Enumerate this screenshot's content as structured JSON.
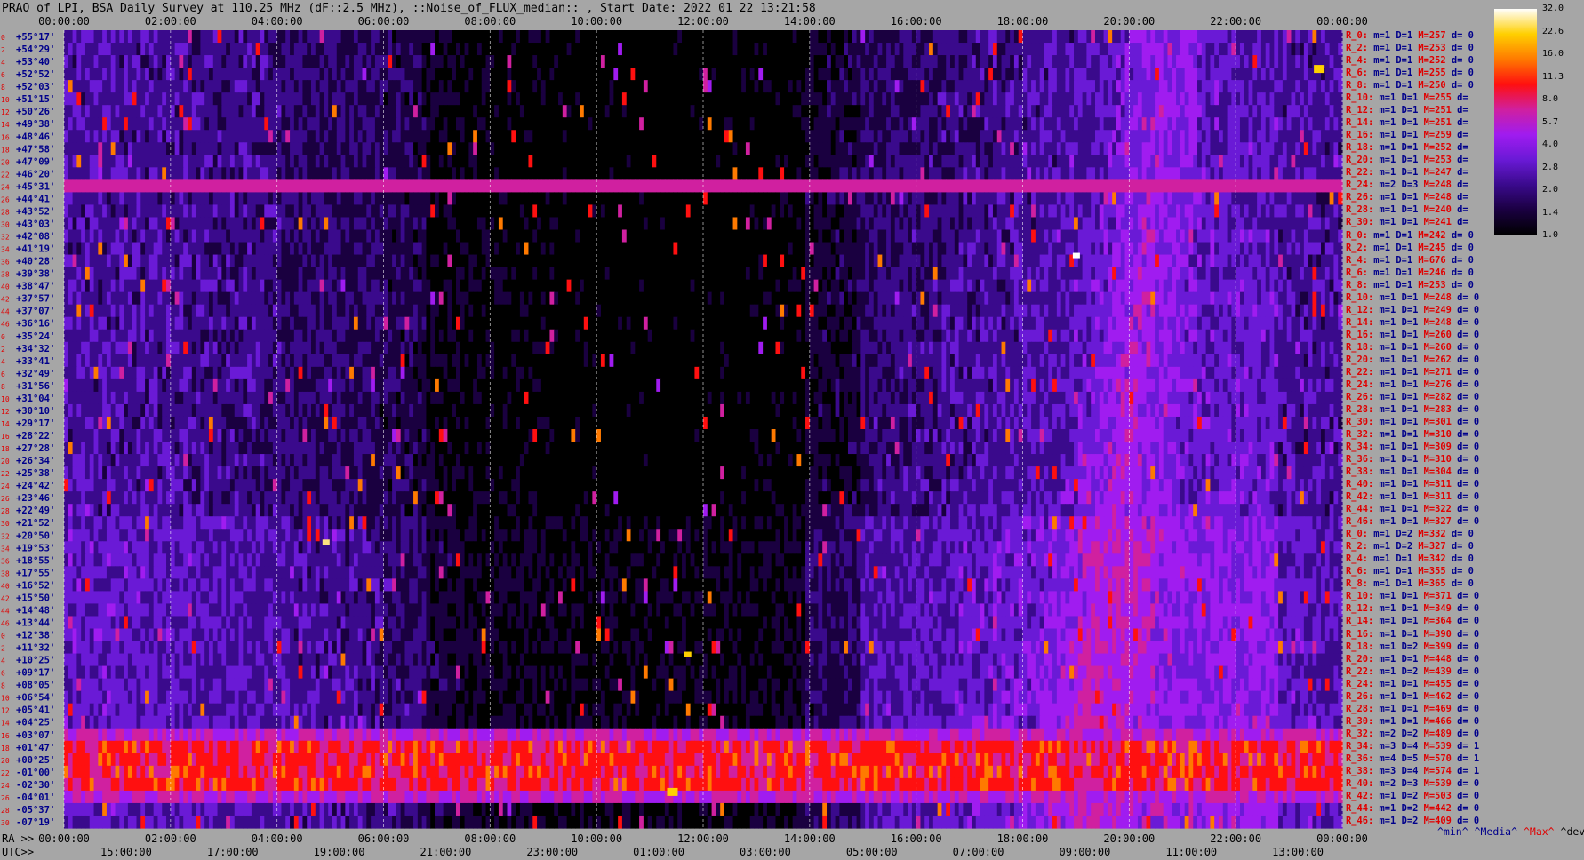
{
  "title": "PRAO of LPI, BSA Daily Survey at 110.25 MHz (dF::2.5 MHz), ::Noise_of_FLUX_median:: , Start Date: 2022 01 22 13:21:58",
  "chart_data": {
    "type": "heatmap",
    "ra_label": "RA >>",
    "utc_label": "UTC>>",
    "top_ticks": [
      "00:00:00",
      "02:00:00",
      "04:00:00",
      "06:00:00",
      "08:00:00",
      "10:00:00",
      "12:00:00",
      "14:00:00",
      "16:00:00",
      "18:00:00",
      "20:00:00",
      "22:00:00",
      "00:00:00"
    ],
    "ra_ticks": [
      "00:00:00",
      "02:00:00",
      "04:00:00",
      "06:00:00",
      "08:00:00",
      "10:00:00",
      "12:00:00",
      "14:00:00",
      "16:00:00",
      "18:00:00",
      "20:00:00",
      "22:00:00",
      "00:00:00"
    ],
    "utc_ticks": [
      "15:00:00",
      "17:00:00",
      "19:00:00",
      "21:00:00",
      "23:00:00",
      "01:00:00",
      "03:00:00",
      "05:00:00",
      "07:00:00",
      "09:00:00",
      "11:00:00",
      "13:00:00"
    ],
    "declinations": [
      "+55°17'",
      "+54°29'",
      "+53°40'",
      "+52°52'",
      "+52°03'",
      "+51°15'",
      "+50°26'",
      "+49°38'",
      "+48°46'",
      "+47°58'",
      "+47°09'",
      "+46°20'",
      "+45°31'",
      "+44°41'",
      "+43°52'",
      "+43°03'",
      "+42°08'",
      "+41°19'",
      "+40°28'",
      "+39°38'",
      "+38°47'",
      "+37°57'",
      "+37°07'",
      "+36°16'",
      "+35°24'",
      "+34°32'",
      "+33°41'",
      "+32°49'",
      "+31°56'",
      "+31°04'",
      "+30°10'",
      "+29°17'",
      "+28°22'",
      "+27°28'",
      "+26°34'",
      "+25°38'",
      "+24°42'",
      "+23°46'",
      "+22°49'",
      "+21°52'",
      "+20°50'",
      "+19°53'",
      "+18°55'",
      "+17°55'",
      "+16°52'",
      "+15°50'",
      "+14°48'",
      "+13°44'",
      "+12°38'",
      "+11°32'",
      "+10°25'",
      "+09°17'",
      "+08°05'",
      "+06°54'",
      "+05°41'",
      "+04°25'",
      "+03°07'",
      "+01°47'",
      "+00°25'",
      "-01°00'",
      "-02°30'",
      "-04°01'",
      "-05°37'",
      "-07°19'"
    ],
    "row_indices": [
      "0",
      "2",
      "4",
      "6",
      "8",
      "10",
      "12",
      "14",
      "16",
      "18",
      "20",
      "22",
      "24",
      "26",
      "28",
      "30",
      "32",
      "34",
      "36",
      "38",
      "40",
      "42",
      "44",
      "46",
      "0",
      "2",
      "4",
      "6",
      "8",
      "10",
      "12",
      "14",
      "16",
      "18",
      "20",
      "22",
      "24",
      "26",
      "28",
      "30",
      "32",
      "34",
      "36",
      "38",
      "40",
      "42",
      "44",
      "46"
    ],
    "rows": [
      {
        "r": "R_0:",
        "m": "1",
        "D": "1",
        "M": "257",
        "d": "0"
      },
      {
        "r": "R_2:",
        "m": "1",
        "D": "1",
        "M": "253",
        "d": "0"
      },
      {
        "r": "R_4:",
        "m": "1",
        "D": "1",
        "M": "252",
        "d": "0"
      },
      {
        "r": "R_6:",
        "m": "1",
        "D": "1",
        "M": "255",
        "d": "0"
      },
      {
        "r": "R_8:",
        "m": "1",
        "D": "1",
        "M": "250",
        "d": "0"
      },
      {
        "r": "R_10:",
        "m": "1",
        "D": "1",
        "M": "255",
        "d": ""
      },
      {
        "r": "R_12:",
        "m": "1",
        "D": "1",
        "M": "251",
        "d": ""
      },
      {
        "r": "R_14:",
        "m": "1",
        "D": "1",
        "M": "251",
        "d": ""
      },
      {
        "r": "R_16:",
        "m": "1",
        "D": "1",
        "M": "259",
        "d": ""
      },
      {
        "r": "R_18:",
        "m": "1",
        "D": "1",
        "M": "252",
        "d": ""
      },
      {
        "r": "R_20:",
        "m": "1",
        "D": "1",
        "M": "253",
        "d": ""
      },
      {
        "r": "R_22:",
        "m": "1",
        "D": "1",
        "M": "247",
        "d": ""
      },
      {
        "r": "R_24:",
        "m": "2",
        "D": "3",
        "M": "248",
        "d": ""
      },
      {
        "r": "R_26:",
        "m": "1",
        "D": "1",
        "M": "248",
        "d": ""
      },
      {
        "r": "R_28:",
        "m": "1",
        "D": "1",
        "M": "240",
        "d": ""
      },
      {
        "r": "R_30:",
        "m": "1",
        "D": "1",
        "M": "241",
        "d": ""
      },
      {
        "r": "R_0:",
        "m": "1",
        "D": "1",
        "M": "242",
        "d": "0"
      },
      {
        "r": "R_2:",
        "m": "1",
        "D": "1",
        "M": "245",
        "d": "0"
      },
      {
        "r": "R_4:",
        "m": "1",
        "D": "1",
        "M": "676",
        "d": "0"
      },
      {
        "r": "R_6:",
        "m": "1",
        "D": "1",
        "M": "246",
        "d": "0"
      },
      {
        "r": "R_8:",
        "m": "1",
        "D": "1",
        "M": "253",
        "d": "0"
      },
      {
        "r": "R_10:",
        "m": "1",
        "D": "1",
        "M": "248",
        "d": "0"
      },
      {
        "r": "R_12:",
        "m": "1",
        "D": "1",
        "M": "249",
        "d": "0"
      },
      {
        "r": "R_14:",
        "m": "1",
        "D": "1",
        "M": "248",
        "d": "0"
      },
      {
        "r": "R_16:",
        "m": "1",
        "D": "1",
        "M": "260",
        "d": "0"
      },
      {
        "r": "R_18:",
        "m": "1",
        "D": "1",
        "M": "260",
        "d": "0"
      },
      {
        "r": "R_20:",
        "m": "1",
        "D": "1",
        "M": "262",
        "d": "0"
      },
      {
        "r": "R_22:",
        "m": "1",
        "D": "1",
        "M": "271",
        "d": "0"
      },
      {
        "r": "R_24:",
        "m": "1",
        "D": "1",
        "M": "276",
        "d": "0"
      },
      {
        "r": "R_26:",
        "m": "1",
        "D": "1",
        "M": "282",
        "d": "0"
      },
      {
        "r": "R_28:",
        "m": "1",
        "D": "1",
        "M": "283",
        "d": "0"
      },
      {
        "r": "R_30:",
        "m": "1",
        "D": "1",
        "M": "301",
        "d": "0"
      },
      {
        "r": "R_32:",
        "m": "1",
        "D": "1",
        "M": "310",
        "d": "0"
      },
      {
        "r": "R_34:",
        "m": "1",
        "D": "1",
        "M": "309",
        "d": "0"
      },
      {
        "r": "R_36:",
        "m": "1",
        "D": "1",
        "M": "310",
        "d": "0"
      },
      {
        "r": "R_38:",
        "m": "1",
        "D": "1",
        "M": "304",
        "d": "0"
      },
      {
        "r": "R_40:",
        "m": "1",
        "D": "1",
        "M": "311",
        "d": "0"
      },
      {
        "r": "R_42:",
        "m": "1",
        "D": "1",
        "M": "311",
        "d": "0"
      },
      {
        "r": "R_44:",
        "m": "1",
        "D": "1",
        "M": "322",
        "d": "0"
      },
      {
        "r": "R_46:",
        "m": "1",
        "D": "1",
        "M": "327",
        "d": "0"
      },
      {
        "r": "R_0:",
        "m": "1",
        "D": "2",
        "M": "332",
        "d": "0"
      },
      {
        "r": "R_2:",
        "m": "1",
        "D": "2",
        "M": "327",
        "d": "0"
      },
      {
        "r": "R_4:",
        "m": "1",
        "D": "1",
        "M": "342",
        "d": "0"
      },
      {
        "r": "R_6:",
        "m": "1",
        "D": "1",
        "M": "355",
        "d": "0"
      },
      {
        "r": "R_8:",
        "m": "1",
        "D": "1",
        "M": "365",
        "d": "0"
      },
      {
        "r": "R_10:",
        "m": "1",
        "D": "1",
        "M": "371",
        "d": "0"
      },
      {
        "r": "R_12:",
        "m": "1",
        "D": "1",
        "M": "349",
        "d": "0"
      },
      {
        "r": "R_14:",
        "m": "1",
        "D": "1",
        "M": "364",
        "d": "0"
      },
      {
        "r": "R_16:",
        "m": "1",
        "D": "1",
        "M": "390",
        "d": "0"
      },
      {
        "r": "R_18:",
        "m": "1",
        "D": "2",
        "M": "399",
        "d": "0"
      },
      {
        "r": "R_20:",
        "m": "1",
        "D": "1",
        "M": "448",
        "d": "0"
      },
      {
        "r": "R_22:",
        "m": "1",
        "D": "2",
        "M": "439",
        "d": "0"
      },
      {
        "r": "R_24:",
        "m": "1",
        "D": "1",
        "M": "455",
        "d": "0"
      },
      {
        "r": "R_26:",
        "m": "1",
        "D": "1",
        "M": "462",
        "d": "0"
      },
      {
        "r": "R_28:",
        "m": "1",
        "D": "1",
        "M": "469",
        "d": "0"
      },
      {
        "r": "R_30:",
        "m": "1",
        "D": "1",
        "M": "466",
        "d": "0"
      },
      {
        "r": "R_32:",
        "m": "2",
        "D": "2",
        "M": "489",
        "d": "0"
      },
      {
        "r": "R_34:",
        "m": "3",
        "D": "4",
        "M": "539",
        "d": "1"
      },
      {
        "r": "R_36:",
        "m": "4",
        "D": "5",
        "M": "570",
        "d": "1"
      },
      {
        "r": "R_38:",
        "m": "3",
        "D": "4",
        "M": "574",
        "d": "1"
      },
      {
        "r": "R_40:",
        "m": "2",
        "D": "3",
        "M": "539",
        "d": "0"
      },
      {
        "r": "R_42:",
        "m": "1",
        "D": "2",
        "M": "503",
        "d": "0"
      },
      {
        "r": "R_44:",
        "m": "1",
        "D": "2",
        "M": "442",
        "d": "0"
      },
      {
        "r": "R_46:",
        "m": "1",
        "D": "2",
        "M": "409",
        "d": "0"
      }
    ],
    "colorbar": {
      "ticks": [
        "32.0",
        "22.6",
        "16.0",
        "11.3",
        "8.0",
        "5.7",
        "4.0",
        "2.8",
        "2.0",
        "1.4",
        "1.0"
      ],
      "scale": "log"
    },
    "legend": {
      "min": "^min^",
      "median": "^Media^",
      "max": "^Max^",
      "devia": "^devia^"
    }
  },
  "colors": {
    "background": "#a6a6a6",
    "ring_label": "#e00000",
    "value_label": "#00008b",
    "colormap": [
      "#000000",
      "#1a0040",
      "#3a0a8c",
      "#6a1ad6",
      "#a01cf0",
      "#d020a0",
      "#ff1010",
      "#ff7a00",
      "#ffd000",
      "#ffffff"
    ]
  }
}
